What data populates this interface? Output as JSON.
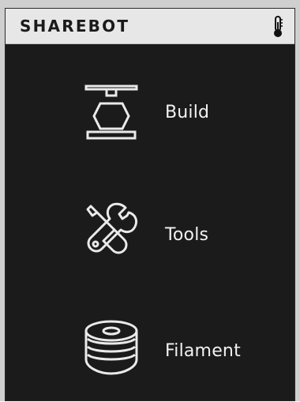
{
  "header": {
    "brand": "SHAREBOT",
    "thermometer_icon": "thermometer-icon"
  },
  "menu": {
    "items": [
      {
        "label": "Build",
        "icon": "build-printer-icon"
      },
      {
        "label": "Tools",
        "icon": "tools-icon"
      },
      {
        "label": "Filament",
        "icon": "filament-spool-icon"
      }
    ]
  },
  "colors": {
    "screen_background": "#1b1b1b",
    "header_background": "#e7e7e7",
    "text_light": "#f2f2f2",
    "text_dark": "#1a1a1a"
  }
}
